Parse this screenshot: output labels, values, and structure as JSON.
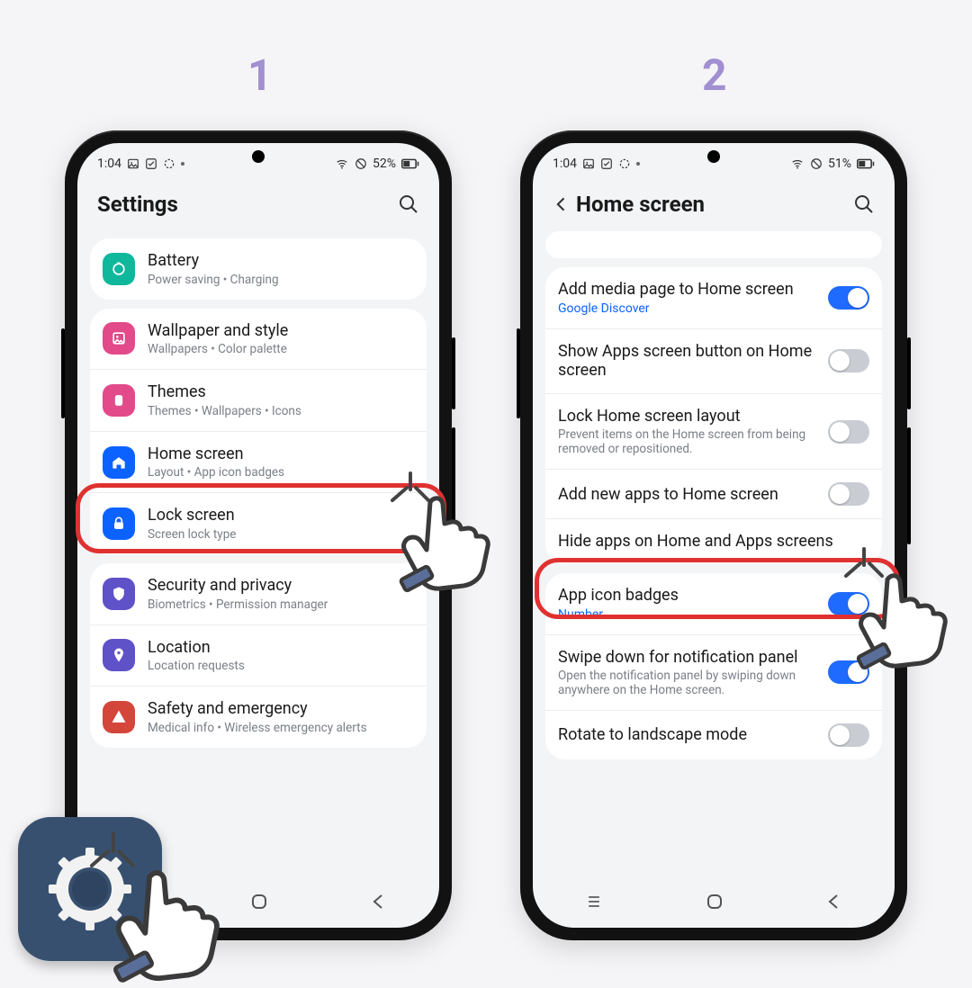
{
  "steps": {
    "one": "1",
    "two": "2"
  },
  "status": {
    "time": "1:04",
    "batt1": "52%",
    "batt2": "51%"
  },
  "phone1": {
    "title": "Settings",
    "items": {
      "battery": {
        "t": "Battery",
        "s": "Power saving  •  Charging"
      },
      "wallpaper": {
        "t": "Wallpaper and style",
        "s": "Wallpapers  •  Color palette"
      },
      "themes": {
        "t": "Themes",
        "s": "Themes  •  Wallpapers  •  Icons"
      },
      "home": {
        "t": "Home screen",
        "s": "Layout  •  App icon badges"
      },
      "lock": {
        "t": "Lock screen",
        "s": "Screen lock type"
      },
      "security": {
        "t": "Security and privacy",
        "s": "Biometrics  •  Permission manager"
      },
      "location": {
        "t": "Location",
        "s": "Location requests"
      },
      "safety": {
        "t": "Safety and emergency",
        "s": "Medical info  •  Wireless emergency alerts"
      }
    }
  },
  "phone2": {
    "title": "Home screen",
    "items": {
      "media": {
        "t": "Add media page to Home screen",
        "l": "Google Discover"
      },
      "appsbtn": {
        "t": "Show Apps screen button on Home screen"
      },
      "locklayout": {
        "t": "Lock Home screen layout",
        "s": "Prevent items on the Home screen from being removed or repositioned."
      },
      "addnew": {
        "t": "Add new apps to Home screen"
      },
      "hide": {
        "t": "Hide apps on Home and Apps screens"
      },
      "badges": {
        "t": "App icon badges",
        "l": "Number"
      },
      "swipe": {
        "t": "Swipe down for notification panel",
        "s": "Open the notification panel by swiping down anywhere on the Home screen."
      },
      "rotate": {
        "t": "Rotate to landscape mode"
      }
    }
  }
}
